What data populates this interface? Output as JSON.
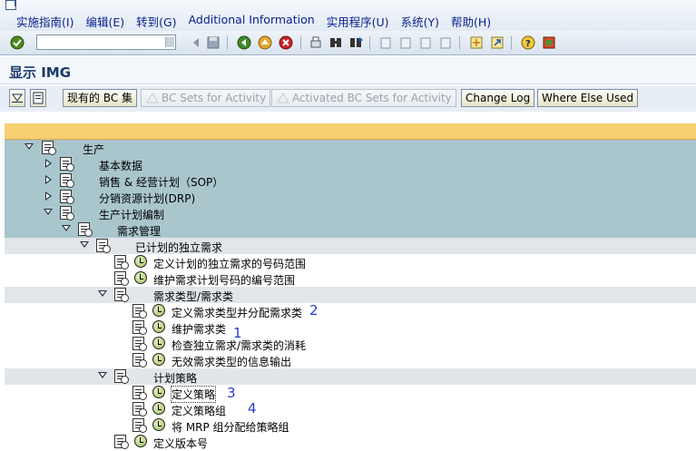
{
  "menubar": {
    "items": [
      "实施指南(I)",
      "编辑(E)",
      "转到(G)",
      "Additional Information",
      "实用程序(U)",
      "系统(Y)",
      "帮助(H)"
    ]
  },
  "toolbar": {
    "command_value": ""
  },
  "screen": {
    "title": "显示 IMG"
  },
  "app_toolbar": {
    "bc_set_label": "现有的 BC 集",
    "bc_sets_activity_label": "BC Sets for Activity",
    "activated_bc_sets_label": "Activated BC Sets for Activity",
    "change_log_label": "Change Log",
    "where_else_used_label": "Where Else Used"
  },
  "tree": {
    "nodes": [
      {
        "label": "生产"
      },
      {
        "label": "基本数据"
      },
      {
        "label": "销售 & 经营计划（SOP）"
      },
      {
        "label": "分销资源计划(DRP)"
      },
      {
        "label": "生产计划编制"
      },
      {
        "label": "需求管理"
      },
      {
        "label": "已计划的独立需求"
      },
      {
        "label": "定义计划的独立需求的号码范围"
      },
      {
        "label": "维护需求计划号码的编号范围"
      },
      {
        "label": "需求类型/需求类"
      },
      {
        "label": "定义需求类型并分配需求类"
      },
      {
        "label": "维护需求类"
      },
      {
        "label": "检查独立需求/需求类的消耗"
      },
      {
        "label": "无效需求类型的信息输出"
      },
      {
        "label": "计划策略"
      },
      {
        "label": "定义策略"
      },
      {
        "label": "定义策略组"
      },
      {
        "label": "将 MRP 组分配给策略组"
      },
      {
        "label": "定义版本号"
      }
    ]
  },
  "annotations": [
    "2",
    "1",
    "3",
    "4"
  ],
  "colors": {
    "header_band": "#f9cf74",
    "structure_row": "#a9c6cd",
    "subgroup_row": "#e2e6ea",
    "annotation": "#2a3bd0"
  }
}
